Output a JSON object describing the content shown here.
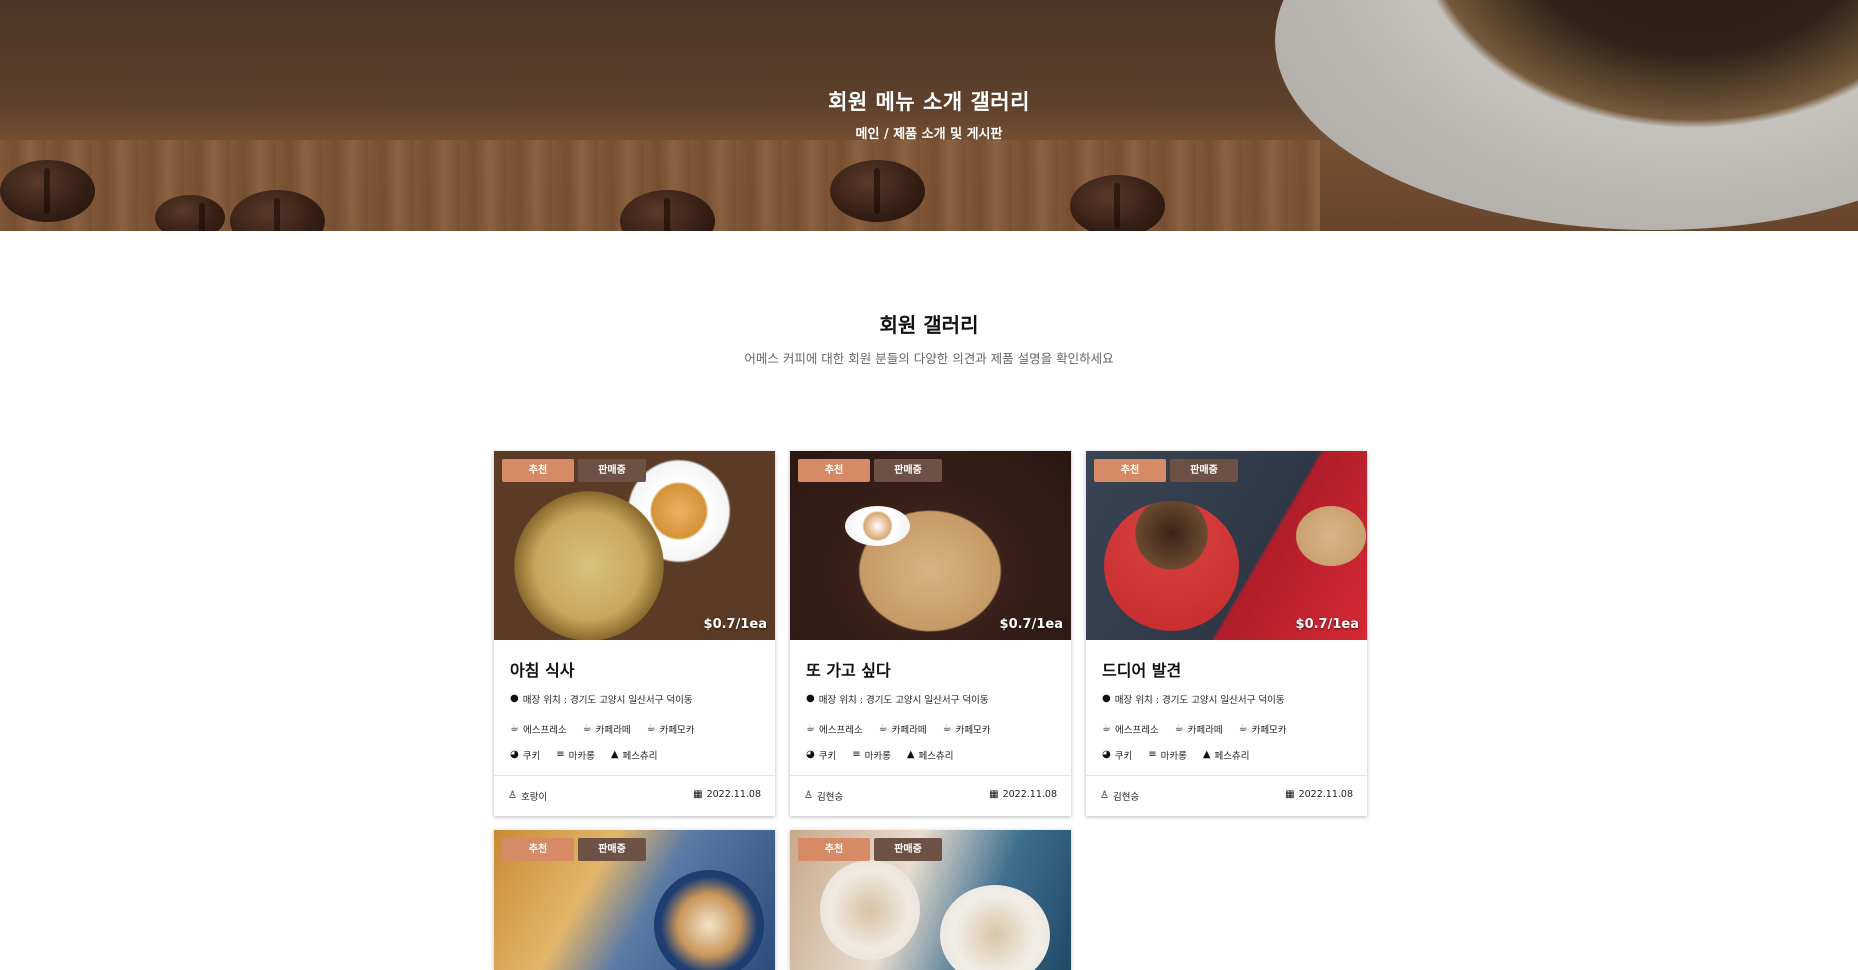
{
  "hero": {
    "title": "회원 메뉴 소개 갤러리",
    "subtitle": "메인 / 제품 소개 및 게시판"
  },
  "section": {
    "title": "회원 갤러리",
    "description": "어메스 커피에 대한 회원 분들의 다양한 의견과 제품 설명을 확인하세요"
  },
  "badges": {
    "recommend": "추천",
    "on_sale": "판매중"
  },
  "cards": [
    {
      "title": "아침 식사",
      "price": "$0.7/1ea",
      "location": "매장 위치 : 경기도 고양시 일산서구 덕이동",
      "tags_row1": [
        "에스프레소",
        "카페라떼",
        "카페모카"
      ],
      "tags_row2": [
        "쿠키",
        "마카롱",
        "페스츄리"
      ],
      "author": "호랑이",
      "date": "2022.11.08"
    },
    {
      "title": "또 가고 싶다",
      "price": "$0.7/1ea",
      "location": "매장 위치 : 경기도 고양시 일산서구 덕이동",
      "tags_row1": [
        "에스프레소",
        "카페라떼",
        "카페모카"
      ],
      "tags_row2": [
        "쿠키",
        "마카롱",
        "페스츄리"
      ],
      "author": "김현승",
      "date": "2022.11.08"
    },
    {
      "title": "드디어 발견",
      "price": "$0.7/1ea",
      "location": "매장 위치 : 경기도 고양시 일산서구 덕이동",
      "tags_row1": [
        "에스프레소",
        "카페라떼",
        "카페모카"
      ],
      "tags_row2": [
        "쿠키",
        "마카롱",
        "페스츄리"
      ],
      "author": "김현승",
      "date": "2022.11.08"
    },
    {
      "title": "",
      "price": ""
    },
    {
      "title": "",
      "price": ""
    }
  ]
}
